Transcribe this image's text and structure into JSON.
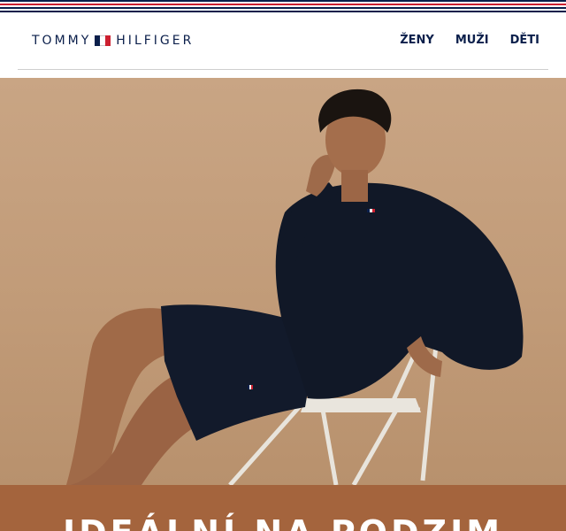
{
  "brand": {
    "logo_left": "TOMMY",
    "logo_right": "HILFIGER",
    "flag_icon": "tommy-flag-icon"
  },
  "colors": {
    "navy": "#0b1f4b",
    "red": "#cc1f2f",
    "hero_bg": "#c19b78",
    "banner_bg": "#a4643d"
  },
  "nav": {
    "items": [
      {
        "label": "ŽENY"
      },
      {
        "label": "MUŽI"
      },
      {
        "label": "DĚTI"
      }
    ]
  },
  "hero": {
    "image": "man-in-navy-lounge-set-on-chair"
  },
  "banner": {
    "title": "IDEÁLNÍ NA PODZIM"
  }
}
